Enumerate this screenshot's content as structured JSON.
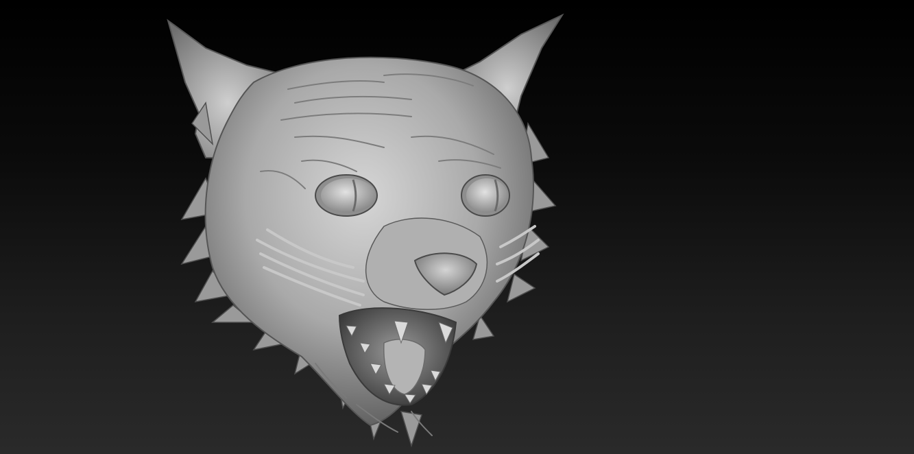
{
  "viewport": {
    "background_top": "#000000",
    "background_bottom": "#2a2a2a",
    "model_color": "#b8b8b8",
    "model_shadow": "#4a4a4a"
  }
}
